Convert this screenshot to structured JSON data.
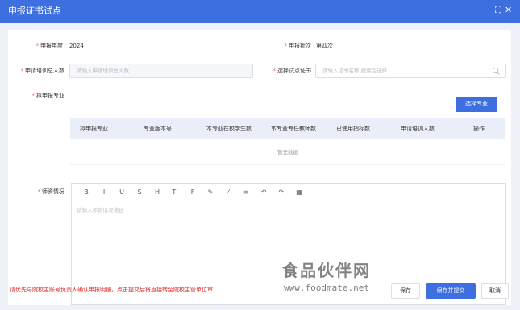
{
  "dialog": {
    "title": "申报证书试点",
    "controls": {
      "expand": "⛶",
      "close": "✕"
    }
  },
  "form": {
    "year": {
      "label": "申报年度",
      "value": "2024"
    },
    "batch": {
      "label": "申报批次",
      "value": "第四次"
    },
    "trainees": {
      "label": "申请培训总人数",
      "placeholder": "请输入申请培训总人数"
    },
    "certificate": {
      "label": "选择试点证书",
      "placeholder": "请输入证书名称 搜索后选择"
    },
    "majors": {
      "label": "拟申报专业",
      "select_button": "选择专业"
    },
    "teachers": {
      "label": "师资情况",
      "placeholder": "请输入师资情况描述"
    }
  },
  "table": {
    "columns": [
      "拟申报专业",
      "专业版本号",
      "本专业在校学生数",
      "本专业专任教师数",
      "已使用指标数",
      "申请培训人数",
      "操作"
    ],
    "empty_text": "暂无数据"
  },
  "toolbar": {
    "items": [
      {
        "name": "bold-icon",
        "glyph": "B"
      },
      {
        "name": "italic-icon",
        "glyph": "I"
      },
      {
        "name": "underline-icon",
        "glyph": "U"
      },
      {
        "name": "strikethrough-icon",
        "glyph": "S"
      },
      {
        "name": "heading-icon",
        "glyph": "H"
      },
      {
        "name": "text-size-icon",
        "glyph": "TI"
      },
      {
        "name": "font-icon",
        "glyph": "F"
      },
      {
        "name": "pen-icon",
        "glyph": "✎"
      },
      {
        "name": "brush-icon",
        "glyph": "⁄"
      },
      {
        "name": "align-icon",
        "glyph": "≡"
      },
      {
        "name": "undo-icon",
        "glyph": "↶"
      },
      {
        "name": "redo-icon",
        "glyph": "↷"
      },
      {
        "name": "table-icon",
        "glyph": "▦"
      }
    ]
  },
  "footer": {
    "note": "请优先与院校主账号负责人确认申报明细，点击提交后将直接转至院校主管单位审",
    "save": "保存",
    "save_submit": "保存并提交",
    "cancel": "取消"
  },
  "watermark": {
    "text": "食品伙伴网",
    "url": "www.foodmate.net"
  },
  "colors": {
    "primary": "#3d6fe0",
    "required": "#f56c6c",
    "warning_text": "#e02020"
  }
}
